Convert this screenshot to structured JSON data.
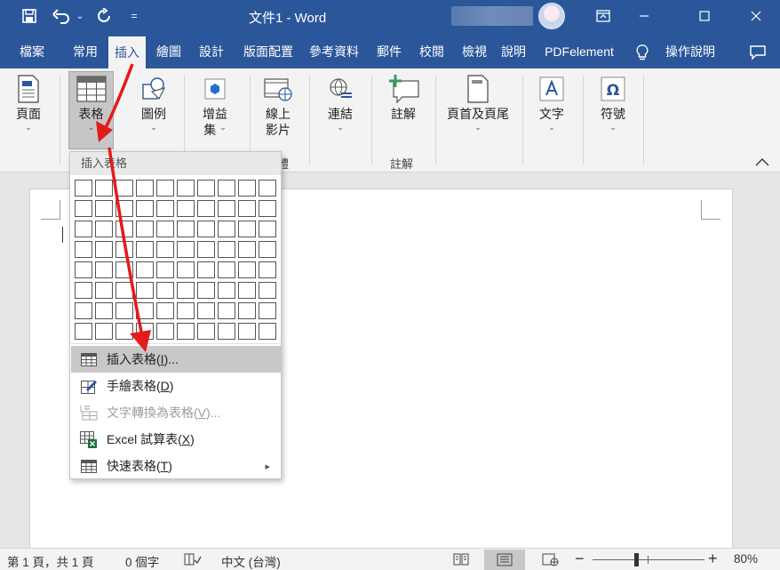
{
  "titlebar": {
    "title": "文件1  -  Word",
    "qat": [
      {
        "icon": "save-icon"
      },
      {
        "icon": "undo-icon",
        "dropdown": "⌄"
      },
      {
        "icon": "redo-icon"
      },
      {
        "icon": "customize-qat-icon",
        "symbol": "="
      }
    ],
    "window": {
      "ribbon_display": "ribbon-display-icon",
      "minimize": "minimize-icon",
      "maximize": "maximize-icon",
      "close": "close-icon"
    }
  },
  "tabs": [
    "檔案",
    "常用",
    "插入",
    "繪圖",
    "設計",
    "版面配置",
    "參考資料",
    "郵件",
    "校閱",
    "檢視",
    "說明",
    "PDFelement"
  ],
  "active_tab": "插入",
  "tell_me": "操作說明",
  "ribbon": {
    "pages": "頁面",
    "table": "表格",
    "illustrations": "圖例",
    "addins_line1": "增益",
    "addins_line2": "集",
    "video_line1": "線上",
    "video_line2": "影片",
    "media_group_partial": "體",
    "links": "連結",
    "comment": "註解",
    "comments_group": "註解",
    "header_footer": "頁首及頁尾",
    "text": "文字",
    "symbols": "符號",
    "chevron": "⌄"
  },
  "dropdown": {
    "header": "插入表格",
    "grid_cols": 10,
    "grid_rows": 8,
    "items": [
      {
        "label": "插入表格(",
        "key": "I",
        "tail": ")...",
        "icon": "insert-table-icon",
        "highlighted": true,
        "disabled": false
      },
      {
        "label": "手繪表格(",
        "key": "D",
        "tail": ")",
        "icon": "draw-table-icon",
        "highlighted": false,
        "disabled": false
      },
      {
        "label": "文字轉換為表格(",
        "key": "V",
        "tail": ")...",
        "icon": "convert-text-table-icon",
        "highlighted": false,
        "disabled": true
      },
      {
        "label": "Excel 試算表(",
        "key": "X",
        "tail": ")",
        "icon": "excel-spreadsheet-icon",
        "highlighted": false,
        "disabled": false
      },
      {
        "label": "快速表格(",
        "key": "T",
        "tail": ")",
        "icon": "quick-tables-icon",
        "highlighted": false,
        "disabled": false,
        "submenu": "▸"
      }
    ]
  },
  "statusbar": {
    "page": "第 1 頁，共 1 頁",
    "words": "0 個字",
    "language": "中文 (台灣)",
    "zoom": "80%",
    "zoom_minus": "−",
    "zoom_plus": "+"
  },
  "colors": {
    "accent": "#2b579a",
    "arrow": "#e21b1b",
    "ribbon": "#f3f3f3"
  }
}
